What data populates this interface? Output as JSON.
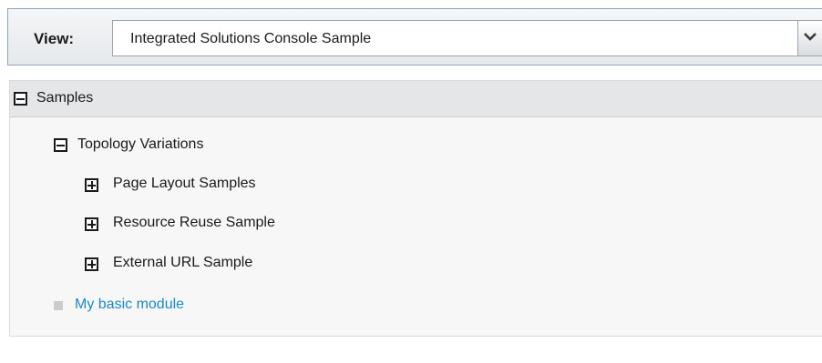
{
  "view": {
    "label": "View:",
    "selected": "Integrated Solutions Console Sample",
    "dropdown_icon": "chevron-down-icon"
  },
  "tree": {
    "root": {
      "label": "Samples",
      "state": "expanded"
    },
    "group": {
      "label": "Topology Variations",
      "state": "expanded",
      "children": [
        {
          "label": "Page Layout Samples",
          "state": "collapsed"
        },
        {
          "label": "Resource Reuse Sample",
          "state": "collapsed"
        },
        {
          "label": "External URL Sample",
          "state": "collapsed"
        }
      ]
    },
    "module_link": {
      "label": "My basic module"
    }
  },
  "colors": {
    "link": "#1a88cf",
    "header_bg": "#e4e6e8",
    "panel_bg": "#f7f7f7",
    "border_accent": "#8aa6c1"
  }
}
